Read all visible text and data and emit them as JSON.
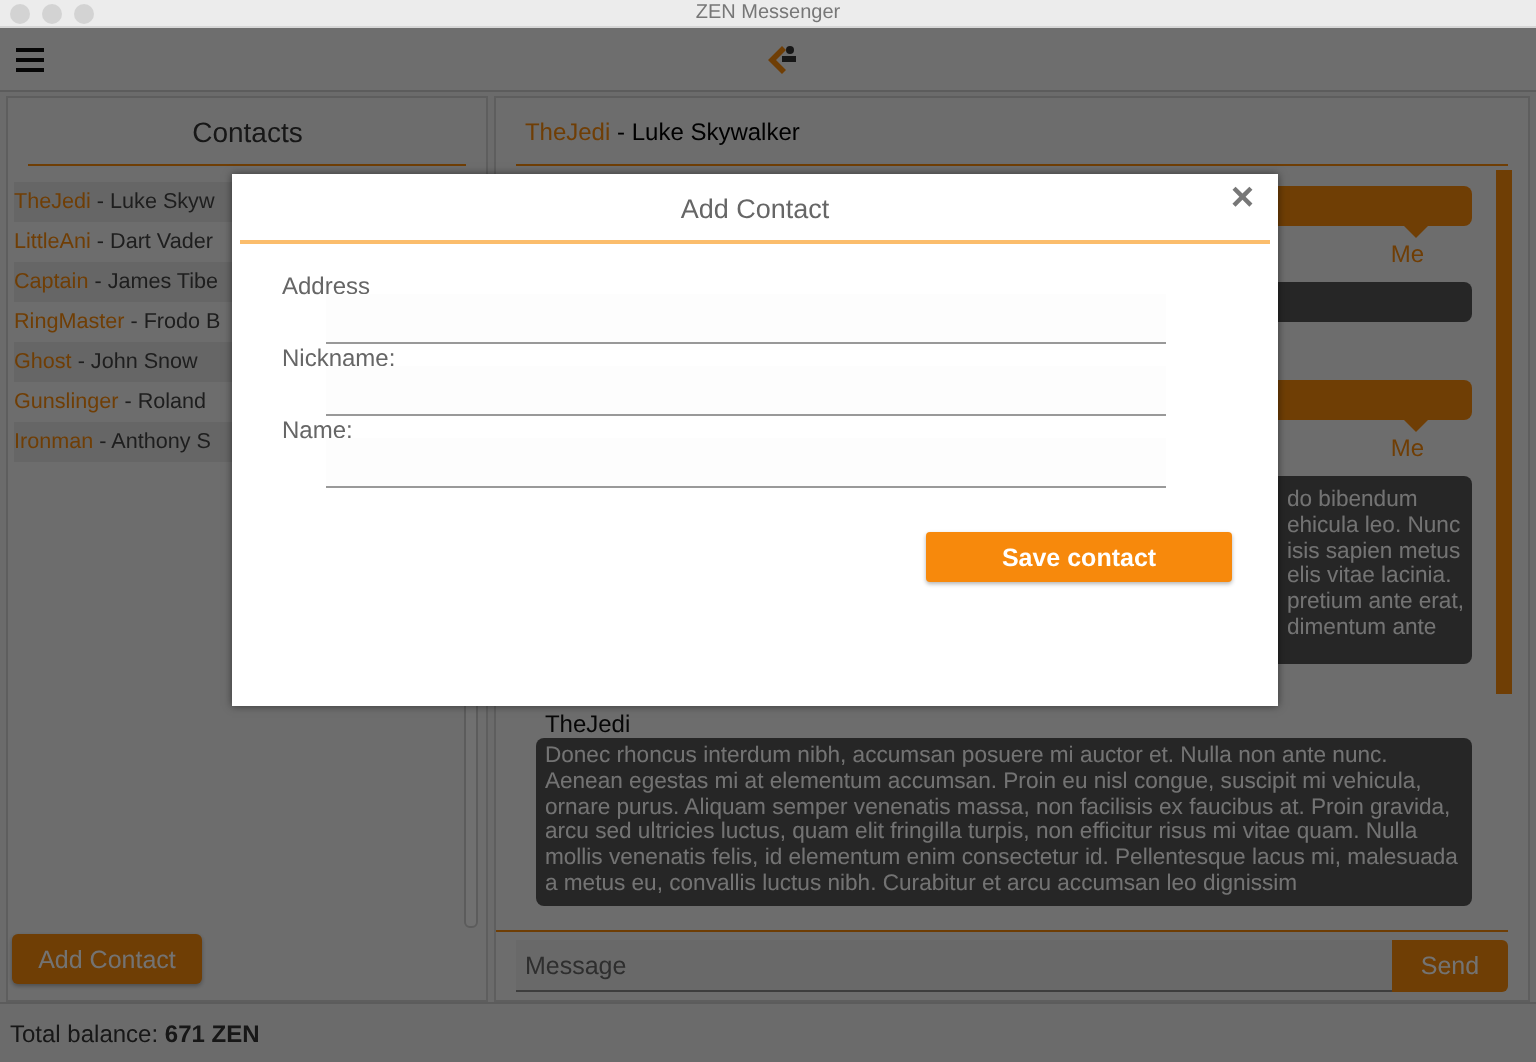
{
  "window": {
    "title": "ZEN Messenger"
  },
  "contacts_panel": {
    "title": "Contacts",
    "contacts": [
      {
        "nickname": "TheJedi",
        "separator": "-",
        "name": "Luke Skyw"
      },
      {
        "nickname": "LittleAni",
        "separator": "-",
        "name": "Dart Vader"
      },
      {
        "nickname": "Captain",
        "separator": "-",
        "name": "James Tibe"
      },
      {
        "nickname": "RingMaster",
        "separator": "-",
        "name": "Frodo B"
      },
      {
        "nickname": "Ghost",
        "separator": "-",
        "name": "John Snow"
      },
      {
        "nickname": "Gunslinger",
        "separator": "-",
        "name": "Roland"
      },
      {
        "nickname": "Ironman",
        "separator": "-",
        "name": "Anthony S"
      }
    ],
    "add_button": "Add Contact"
  },
  "chat": {
    "header": {
      "nickname": "TheJedi",
      "separator": "-",
      "name": "Luke Skywalker"
    },
    "messages": [
      {
        "kind": "mine",
        "sender": "Me"
      },
      {
        "kind": "theirs"
      },
      {
        "kind": "mine",
        "sender": "Me"
      },
      {
        "kind": "theirs",
        "partial": true,
        "text": "do bibendum\nehicula leo. Nunc\nisis sapien metus\nelis vitae lacinia.\npretium ante erat,\ndimentum ante"
      },
      {
        "kind": "theirs",
        "sender": "TheJedi",
        "text": "Donec rhoncus interdum nibh, accumsan posuere mi auctor et. Nulla non ante nunc. Aenean egestas mi at elementum accumsan. Proin eu nisl congue, suscipit mi vehicula, ornare purus. Aliquam semper venenatis massa, non facilisis ex faucibus at. Proin gravida, arcu sed ultricies luctus, quam elit fringilla turpis, non efficitur risus mi vitae quam. Nulla mollis venenatis felis, id elementum enim consectetur id. Pellentesque lacus mi, malesuada a metus eu, convallis luctus nibh. Curabitur et arcu accumsan leo dignissim"
      }
    ],
    "message_input": {
      "placeholder": "Message"
    },
    "send_button": "Send"
  },
  "status_bar": {
    "balance": "Total balance: **671 ZEN**"
  },
  "modal": {
    "title": "Add Contact",
    "close": "×",
    "fields": [
      {
        "label": "Address"
      },
      {
        "label": "Nickname:"
      },
      {
        "label": "Name:"
      }
    ],
    "save_button": "Save contact"
  }
}
